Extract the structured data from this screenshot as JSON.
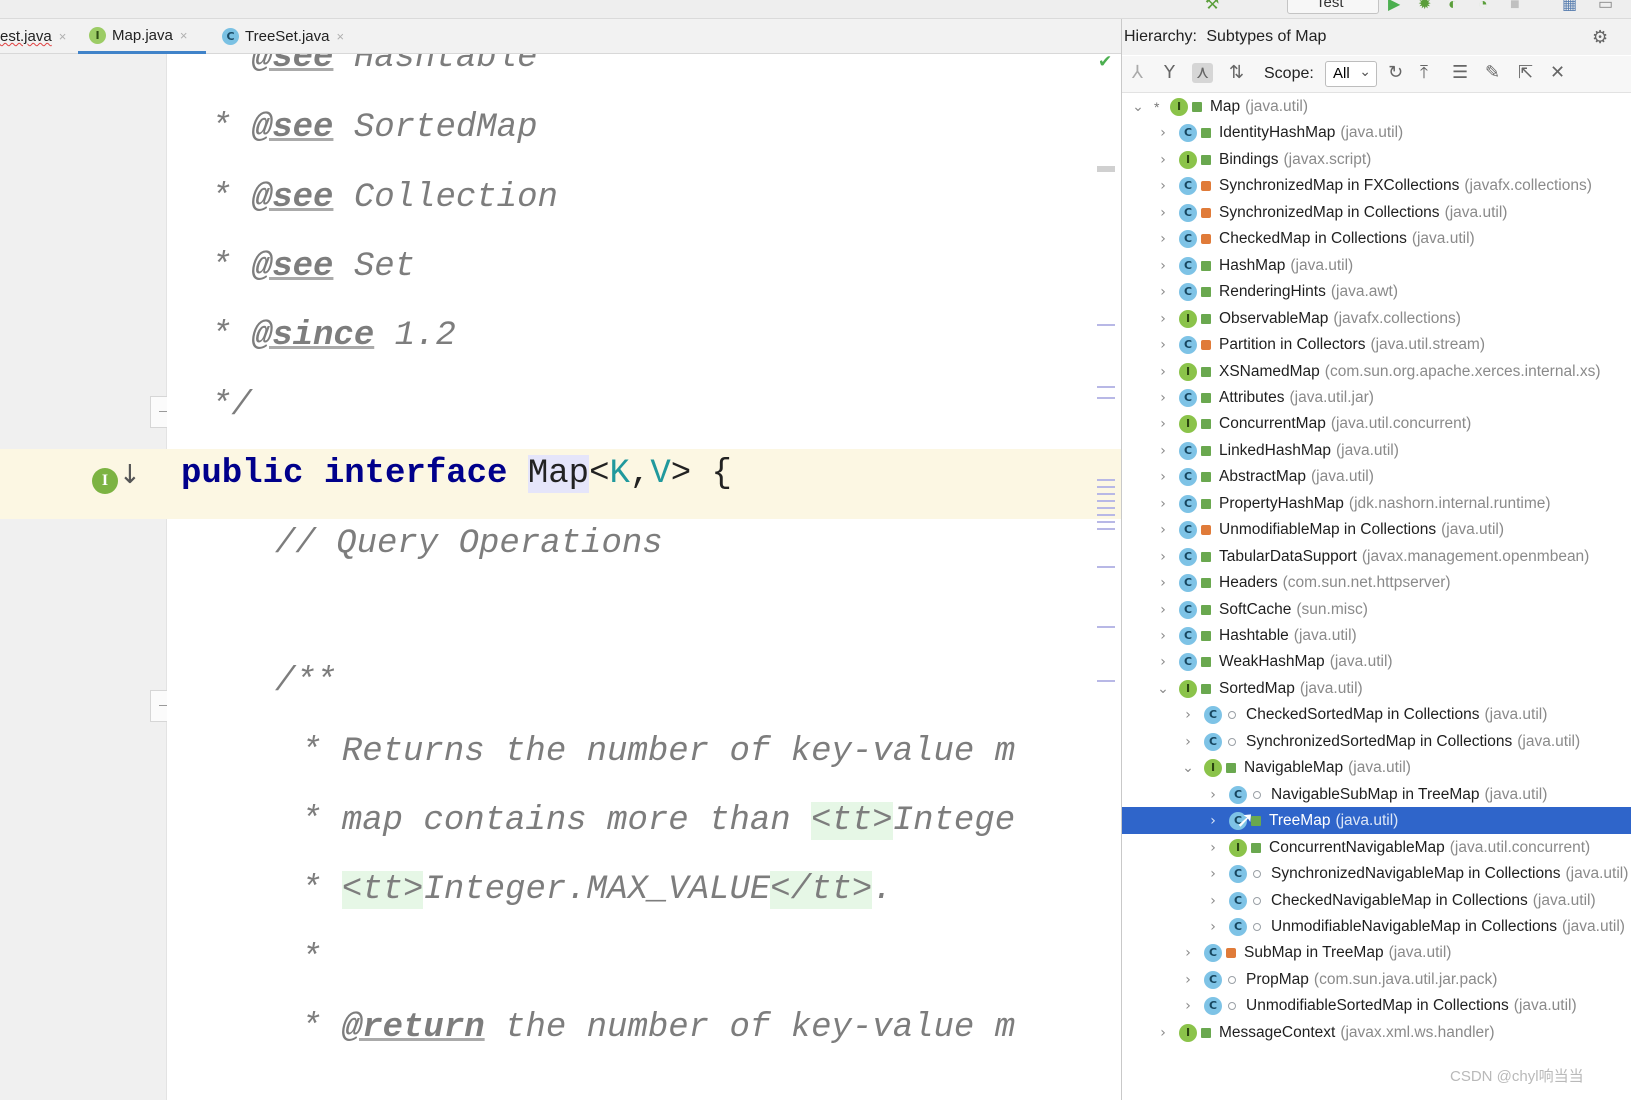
{
  "toolbar": {
    "run_config": "Test"
  },
  "tabs": [
    {
      "label": "est.java",
      "kind": "",
      "close": "×"
    },
    {
      "label": "Map.java",
      "kind": "I",
      "close": "×"
    },
    {
      "label": "TreeSet.java",
      "kind": "C",
      "close": "×"
    }
  ],
  "editor": {
    "lines": {
      "l0_star": "* ",
      "l0_tag": "@see",
      "l0_text": " Hashtable",
      "l1_star": "* ",
      "l1_tag": "@see",
      "l1_text": " SortedMap",
      "l2_star": "* ",
      "l2_tag": "@see",
      "l2_text": " Collection",
      "l3_star": "* ",
      "l3_tag": "@see",
      "l3_text": " Set",
      "l4_star": "* ",
      "l4_tag": "@since",
      "l4_text": " 1.2",
      "l5": "*/",
      "l6_kw1": "public",
      "l6_kw2": "interface",
      "l6_name": "Map",
      "l6_lt": "<",
      "l6_k": "K",
      "l6_comma": ",",
      "l6_v": "V",
      "l6_rest": "> {",
      "l7": "// Query Operations",
      "l8": "/**",
      "l9": "* Returns the number of key-value m",
      "l10_a": "* map contains more than ",
      "l10_b": "<tt>",
      "l10_c": "Intege",
      "l11_a": "* ",
      "l11_b": "<tt>",
      "l11_c": "Integer.MAX_VALUE",
      "l11_d": "</tt>",
      "l11_e": ".",
      "l12": "*",
      "l13_a": "* ",
      "l13_tag": "@return",
      "l13_b": " the number of key-value m"
    }
  },
  "hierarchy": {
    "title": "Hierarchy:",
    "subtitle": "Subtypes of Map",
    "scope_label": "Scope:",
    "scope_value": "All",
    "rows": [
      {
        "name": "Map",
        "pkg": "(java.util)",
        "kind": "I",
        "vis": "public",
        "level": 0,
        "arrow": "⌄",
        "star": "*"
      },
      {
        "name": "IdentityHashMap",
        "pkg": "(java.util)",
        "kind": "C",
        "vis": "public",
        "level": 1,
        "arrow": "›"
      },
      {
        "name": "Bindings",
        "pkg": "(javax.script)",
        "kind": "I",
        "vis": "public",
        "level": 1,
        "arrow": "›"
      },
      {
        "name": "SynchronizedMap in FXCollections",
        "pkg": "(javafx.collections)",
        "kind": "C",
        "vis": "private",
        "level": 1,
        "arrow": "›"
      },
      {
        "name": "SynchronizedMap in Collections",
        "pkg": "(java.util)",
        "kind": "C",
        "vis": "private",
        "level": 1,
        "arrow": "›"
      },
      {
        "name": "CheckedMap in Collections",
        "pkg": "(java.util)",
        "kind": "C",
        "vis": "private",
        "level": 1,
        "arrow": "›"
      },
      {
        "name": "HashMap",
        "pkg": "(java.util)",
        "kind": "C",
        "vis": "public",
        "level": 1,
        "arrow": "›"
      },
      {
        "name": "RenderingHints",
        "pkg": "(java.awt)",
        "kind": "C",
        "vis": "public",
        "level": 1,
        "arrow": "›"
      },
      {
        "name": "ObservableMap",
        "pkg": "(javafx.collections)",
        "kind": "I",
        "vis": "public",
        "level": 1,
        "arrow": "›"
      },
      {
        "name": "Partition in Collectors",
        "pkg": "(java.util.stream)",
        "kind": "C",
        "vis": "private",
        "level": 1,
        "arrow": "›"
      },
      {
        "name": "XSNamedMap",
        "pkg": "(com.sun.org.apache.xerces.internal.xs)",
        "kind": "I",
        "vis": "public",
        "level": 1,
        "arrow": "›"
      },
      {
        "name": "Attributes",
        "pkg": "(java.util.jar)",
        "kind": "C",
        "vis": "public",
        "level": 1,
        "arrow": "›"
      },
      {
        "name": "ConcurrentMap",
        "pkg": "(java.util.concurrent)",
        "kind": "I",
        "vis": "public",
        "level": 1,
        "arrow": "›"
      },
      {
        "name": "LinkedHashMap",
        "pkg": "(java.util)",
        "kind": "C",
        "vis": "public",
        "level": 1,
        "arrow": "›"
      },
      {
        "name": "AbstractMap",
        "pkg": "(java.util)",
        "kind": "C",
        "vis": "public",
        "level": 1,
        "arrow": "›"
      },
      {
        "name": "PropertyHashMap",
        "pkg": "(jdk.nashorn.internal.runtime)",
        "kind": "C",
        "vis": "public",
        "level": 1,
        "arrow": "›"
      },
      {
        "name": "UnmodifiableMap in Collections",
        "pkg": "(java.util)",
        "kind": "C",
        "vis": "private",
        "level": 1,
        "arrow": "›"
      },
      {
        "name": "TabularDataSupport",
        "pkg": "(javax.management.openmbean)",
        "kind": "C",
        "vis": "public",
        "level": 1,
        "arrow": "›"
      },
      {
        "name": "Headers",
        "pkg": "(com.sun.net.httpserver)",
        "kind": "C",
        "vis": "public",
        "level": 1,
        "arrow": "›"
      },
      {
        "name": "SoftCache",
        "pkg": "(sun.misc)",
        "kind": "C",
        "vis": "public",
        "level": 1,
        "arrow": "›"
      },
      {
        "name": "Hashtable",
        "pkg": "(java.util)",
        "kind": "C",
        "vis": "public",
        "level": 1,
        "arrow": "›"
      },
      {
        "name": "WeakHashMap",
        "pkg": "(java.util)",
        "kind": "C",
        "vis": "public",
        "level": 1,
        "arrow": "›"
      },
      {
        "name": "SortedMap",
        "pkg": "(java.util)",
        "kind": "I",
        "vis": "public",
        "level": 1,
        "arrow": "⌄"
      },
      {
        "name": "CheckedSortedMap in Collections",
        "pkg": "(java.util)",
        "kind": "C",
        "vis": "package",
        "level": 2,
        "arrow": "›"
      },
      {
        "name": "SynchronizedSortedMap in Collections",
        "pkg": "(java.util)",
        "kind": "C",
        "vis": "package",
        "level": 2,
        "arrow": "›"
      },
      {
        "name": "NavigableMap",
        "pkg": "(java.util)",
        "kind": "I",
        "vis": "public",
        "level": 2,
        "arrow": "⌄"
      },
      {
        "name": "NavigableSubMap in TreeMap",
        "pkg": "(java.util)",
        "kind": "C",
        "vis": "package",
        "level": 3,
        "arrow": "›"
      },
      {
        "name": "TreeMap",
        "pkg": "(java.util)",
        "kind": "C",
        "vis": "public",
        "level": 3,
        "arrow": "›",
        "selected": true
      },
      {
        "name": "ConcurrentNavigableMap",
        "pkg": "(java.util.concurrent)",
        "kind": "I",
        "vis": "public",
        "level": 3,
        "arrow": "›"
      },
      {
        "name": "SynchronizedNavigableMap in Collections",
        "pkg": "(java.util)",
        "kind": "C",
        "vis": "package",
        "level": 3,
        "arrow": "›"
      },
      {
        "name": "CheckedNavigableMap in Collections",
        "pkg": "(java.util)",
        "kind": "C",
        "vis": "package",
        "level": 3,
        "arrow": "›"
      },
      {
        "name": "UnmodifiableNavigableMap in Collections",
        "pkg": "(java.util)",
        "kind": "C",
        "vis": "package",
        "level": 3,
        "arrow": "›"
      },
      {
        "name": "SubMap in TreeMap",
        "pkg": "(java.util)",
        "kind": "C",
        "vis": "private",
        "level": 2,
        "arrow": "›"
      },
      {
        "name": "PropMap",
        "pkg": "(com.sun.java.util.jar.pack)",
        "kind": "C",
        "vis": "package",
        "level": 2,
        "arrow": "›"
      },
      {
        "name": "UnmodifiableSortedMap in Collections",
        "pkg": "(java.util)",
        "kind": "C",
        "vis": "package",
        "level": 2,
        "arrow": "›"
      },
      {
        "name": "MessageContext",
        "pkg": "(javax.xml.ws.handler)",
        "kind": "I",
        "vis": "public",
        "level": 1,
        "arrow": "›"
      }
    ]
  },
  "watermark": "CSDN @chyl响当当"
}
